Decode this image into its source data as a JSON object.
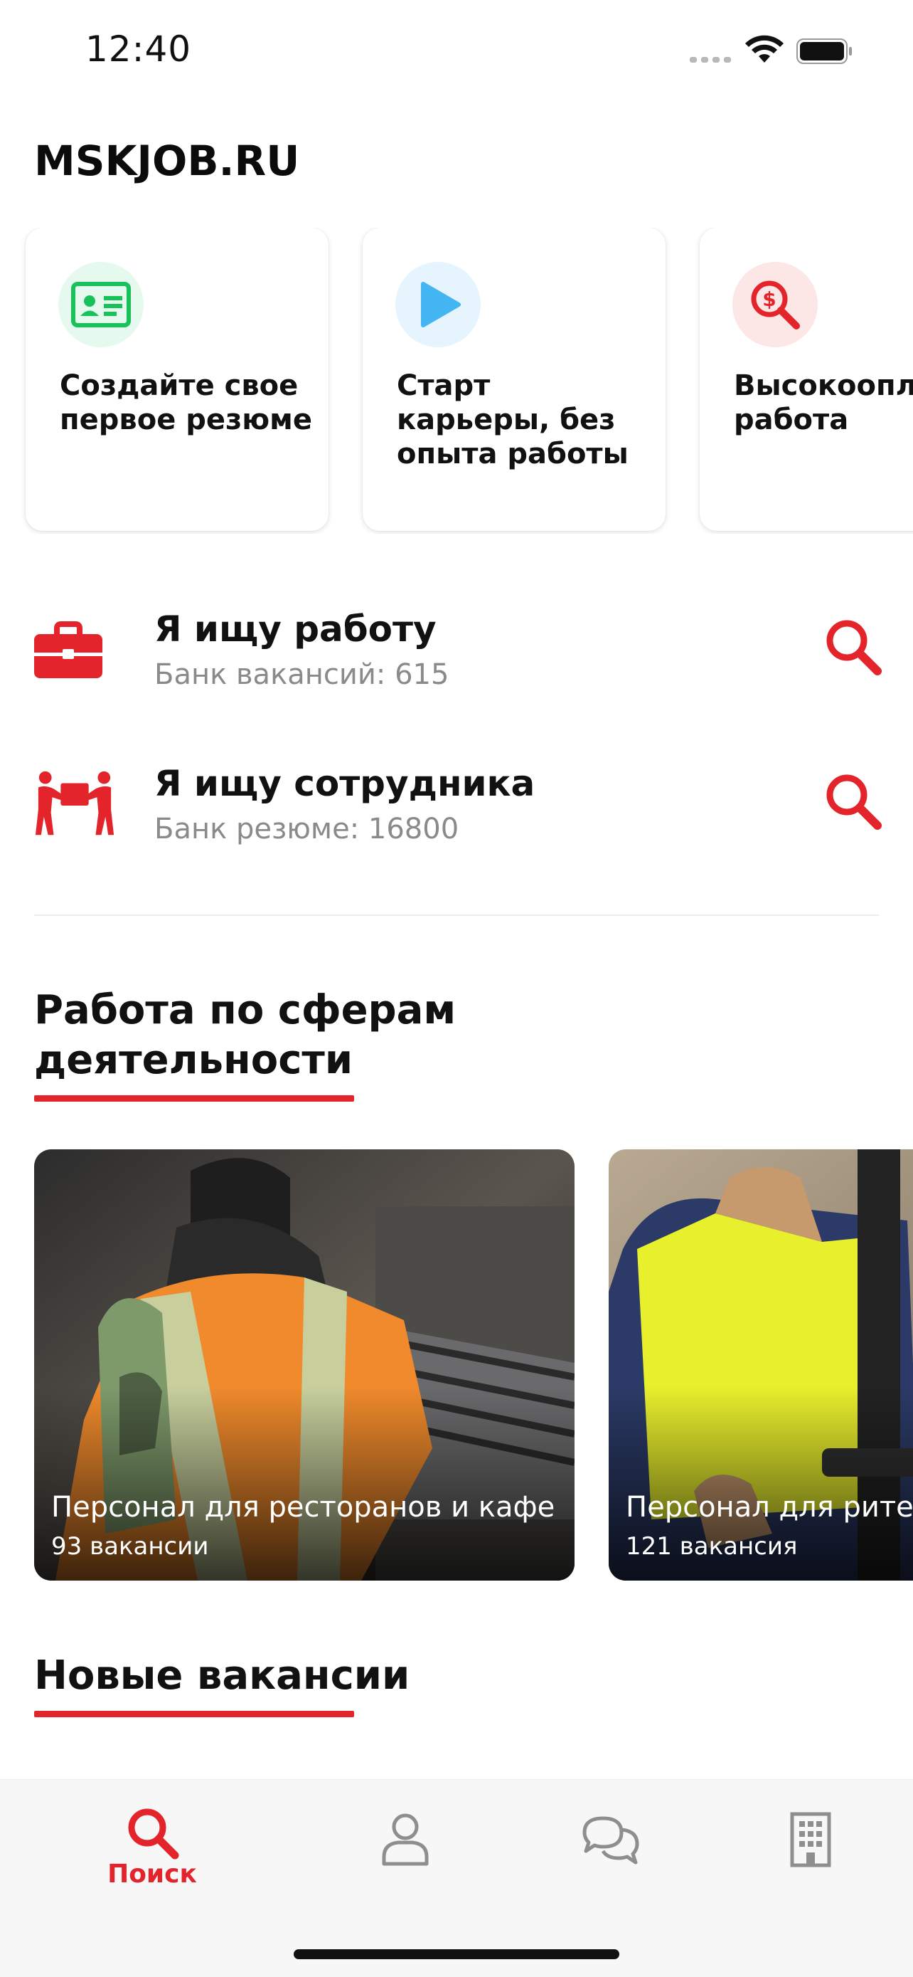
{
  "status_bar": {
    "time": "12:40"
  },
  "header": {
    "title": "MSKJOB.RU"
  },
  "promo_cards": [
    {
      "icon": "id-card-icon",
      "text": "Создайте свое первое резюме",
      "icon_bg": "#e6f9ee",
      "icon_color": "#19c15a"
    },
    {
      "icon": "play-icon",
      "text": "Старт карьеры, без опыта работы",
      "icon_bg": "#e6f5fd",
      "icon_color": "#43b5f0"
    },
    {
      "icon": "money-search-icon",
      "text": "Высокооплачиваемая работа",
      "icon_bg": "#fde6e6",
      "icon_color": "#e3242b"
    }
  ],
  "search_rows": [
    {
      "icon": "briefcase-icon",
      "title": "Я ищу работу",
      "subtitle": "Банк вакансий: 615"
    },
    {
      "icon": "people-carrying-box-icon",
      "title": "Я ищу сотрудника",
      "subtitle": "Банк резюме: 16800"
    }
  ],
  "sections": {
    "categories_title": "Работа по сферам деятельности",
    "new_vacancies_title": "Новые вакансии"
  },
  "categories": [
    {
      "name": "Персонал для ресторанов и кафе",
      "count": "93 вакансии"
    },
    {
      "name": "Персонал для ритейла",
      "count": "121 вакансия"
    }
  ],
  "tab_bar": {
    "tabs": [
      {
        "icon": "search-icon",
        "label": "Поиск",
        "active": true
      },
      {
        "icon": "user-icon",
        "label": "",
        "active": false
      },
      {
        "icon": "chat-icon",
        "label": "",
        "active": false
      },
      {
        "icon": "building-icon",
        "label": "",
        "active": false
      }
    ]
  },
  "colors": {
    "accent": "#e3242b",
    "muted": "#8a8a8a",
    "tab_inactive": "#8e8e8e"
  }
}
